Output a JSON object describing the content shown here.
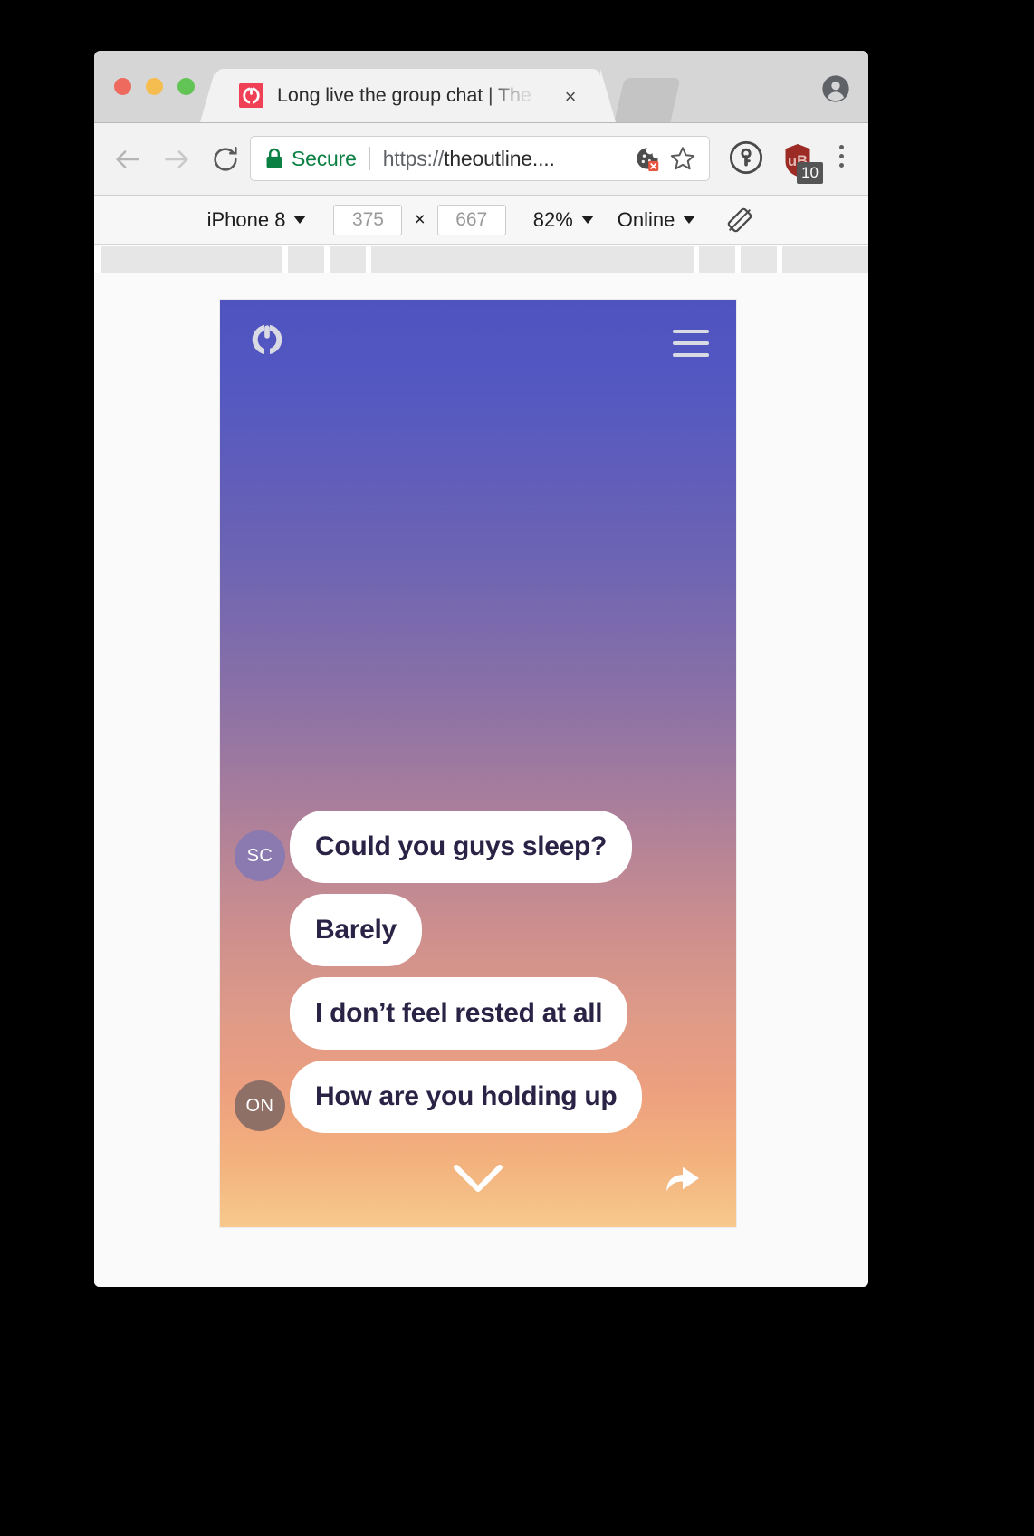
{
  "browser": {
    "tab": {
      "title": "Long live the group chat | The",
      "favicon_name": "outline-logo-icon",
      "close_label": "×"
    },
    "traffic_lights": [
      "close",
      "minimize",
      "zoom"
    ],
    "profile_icon": "account-avatar-icon",
    "toolbar": {
      "back_icon": "back-arrow-icon",
      "forward_icon": "forward-arrow-icon",
      "reload_icon": "reload-icon",
      "security_label": "Secure",
      "url_scheme": "https://",
      "url_host": "theoutline....",
      "cookie_icon": "cookie-blocked-icon",
      "bookmark_icon": "star-icon",
      "password_icon": "1password-icon",
      "ublock_icon": "ublock-shield-icon",
      "ublock_badge": "10",
      "menu_icon": "kebab-menu-icon"
    },
    "device_bar": {
      "device": "iPhone 8",
      "width": "375",
      "height": "667",
      "times": "×",
      "zoom": "82%",
      "throttling": "Online",
      "rotate_icon": "rotate-device-icon"
    }
  },
  "page": {
    "header": {
      "logo_name": "outline-logo-icon",
      "menu_icon": "hamburger-menu-icon"
    },
    "messages": [
      {
        "avatar": "SC",
        "avatar_color": "#8a7ab0",
        "text": "Could you guys sleep?"
      },
      {
        "avatar": "",
        "avatar_color": "",
        "text": "Barely"
      },
      {
        "avatar": "",
        "avatar_color": "",
        "text": "I don’t feel rested at all"
      },
      {
        "avatar": "ON",
        "avatar_color": "#8f7067",
        "text": "How are you holding up"
      }
    ],
    "footer": {
      "scroll_down_icon": "chevron-down-icon",
      "share_icon": "share-forward-arrow-icon"
    },
    "gradient": {
      "top": "#4f53bf",
      "mid": "#cd8f8e",
      "bottom": "#f6c98c"
    },
    "bubble_text_color": "#2b2346"
  }
}
